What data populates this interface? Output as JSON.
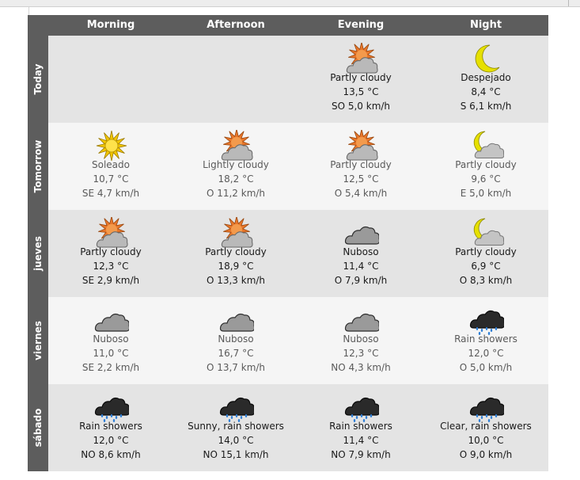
{
  "columns": [
    "Morning",
    "Afternoon",
    "Evening",
    "Night"
  ],
  "rows": [
    {
      "day": "Today",
      "cells": [
        null,
        null,
        {
          "icon": "partly-cloudy-icon",
          "condition": "Partly cloudy",
          "temp": "13,5 °C",
          "wind": "SO 5,0 km/h"
        },
        {
          "icon": "moon-icon",
          "condition": "Despejado",
          "temp": "8,4 °C",
          "wind": "S 6,1 km/h"
        }
      ]
    },
    {
      "day": "Tomorrow",
      "cells": [
        {
          "icon": "sun-icon",
          "condition": "Soleado",
          "temp": "10,7 °C",
          "wind": "SE 4,7 km/h"
        },
        {
          "icon": "partly-cloudy-icon",
          "condition": "Lightly cloudy",
          "temp": "18,2 °C",
          "wind": "O 11,2 km/h"
        },
        {
          "icon": "partly-cloudy-icon",
          "condition": "Partly cloudy",
          "temp": "12,5 °C",
          "wind": "O 5,4 km/h"
        },
        {
          "icon": "moon-cloud-icon",
          "condition": "Partly cloudy",
          "temp": "9,6 °C",
          "wind": "E 5,0 km/h"
        }
      ]
    },
    {
      "day": "jueves",
      "cells": [
        {
          "icon": "partly-cloudy-icon",
          "condition": "Partly cloudy",
          "temp": "12,3 °C",
          "wind": "SE 2,9 km/h"
        },
        {
          "icon": "partly-cloudy-icon",
          "condition": "Partly cloudy",
          "temp": "18,9 °C",
          "wind": "O 13,3 km/h"
        },
        {
          "icon": "cloud-icon",
          "condition": "Nuboso",
          "temp": "11,4 °C",
          "wind": "O 7,9 km/h"
        },
        {
          "icon": "moon-cloud-icon",
          "condition": "Partly cloudy",
          "temp": "6,9 °C",
          "wind": "O 8,3 km/h"
        }
      ]
    },
    {
      "day": "viernes",
      "cells": [
        {
          "icon": "cloud-icon",
          "condition": "Nuboso",
          "temp": "11,0 °C",
          "wind": "SE 2,2 km/h"
        },
        {
          "icon": "cloud-icon",
          "condition": "Nuboso",
          "temp": "16,7 °C",
          "wind": "O 13,7 km/h"
        },
        {
          "icon": "cloud-icon",
          "condition": "Nuboso",
          "temp": "12,3 °C",
          "wind": "NO 4,3 km/h"
        },
        {
          "icon": "rain-cloud-icon",
          "condition": "Rain showers",
          "temp": "12,0 °C",
          "wind": "O 5,0 km/h"
        }
      ]
    },
    {
      "day": "sábado",
      "cells": [
        {
          "icon": "rain-cloud-icon",
          "condition": "Rain showers",
          "temp": "12,0 °C",
          "wind": "NO 8,6 km/h"
        },
        {
          "icon": "rain-cloud-icon",
          "condition": "Sunny, rain showers",
          "temp": "14,0 °C",
          "wind": "NO 15,1 km/h"
        },
        {
          "icon": "rain-cloud-icon",
          "condition": "Rain showers",
          "temp": "11,4 °C",
          "wind": "NO 7,9 km/h"
        },
        {
          "icon": "rain-cloud-icon",
          "condition": "Clear, rain showers",
          "temp": "10,0 °C",
          "wind": "O 9,0 km/h"
        }
      ]
    }
  ]
}
